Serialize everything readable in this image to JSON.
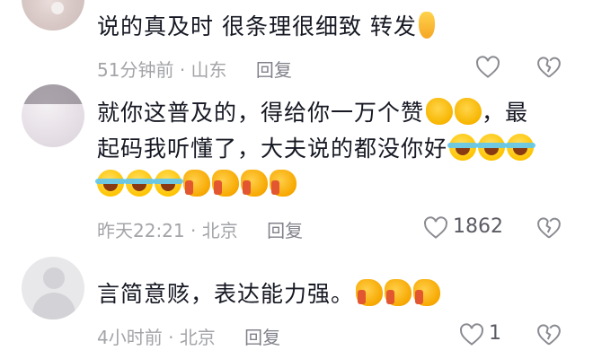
{
  "comments": [
    {
      "text": "说的真及时 很条理很细致 转发",
      "time": "51分钟前",
      "location": "山东",
      "reply_label": "回复",
      "like_count": "",
      "emojis": [
        "pinch-heart-emoji"
      ]
    },
    {
      "text_line1": "就你这普及的，得给你一万个赞",
      "text_line1_end": "，最",
      "text_line2": "起码我听懂了，大夫说的都没你好",
      "time": "昨天22:21",
      "location": "北京",
      "reply_label": "回复",
      "like_count": "1862"
    },
    {
      "text": "言简意赅，表达能力强。",
      "time": "4小时前",
      "location": "北京",
      "reply_label": "回复",
      "like_count": "1"
    }
  ],
  "separator": "·",
  "colors": {
    "text": "#161823",
    "meta": "#a3a4a8",
    "icon": "#8a8b91"
  }
}
